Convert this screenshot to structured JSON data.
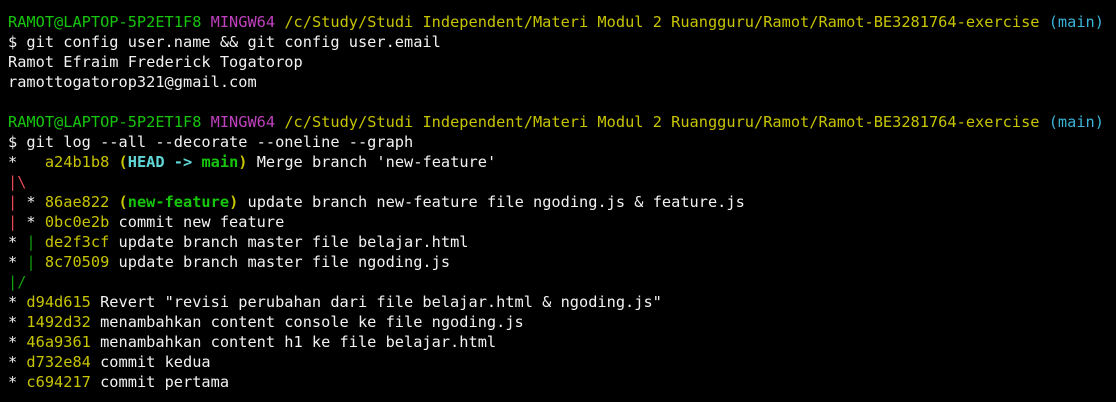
{
  "prompt1": {
    "user": "RAMOT@LAPTOP-5P2ET1F8",
    "shell": "MINGW64",
    "path": "/c/Study/Studi Independent/Materi Modul 2 Ruangguru/Ramot/Ramot-BE3281764-exercise",
    "branch": "(main)"
  },
  "cmd1": "$ git config user.name && git config user.email",
  "out_name": "Ramot Efraim Frederick Togatorop",
  "out_email": "ramottogatorop321@gmail.com",
  "prompt2": {
    "user": "RAMOT@LAPTOP-5P2ET1F8",
    "shell": "MINGW64",
    "path": "/c/Study/Studi Independent/Materi Modul 2 Ruangguru/Ramot/Ramot-BE3281764-exercise",
    "branch": "(main)"
  },
  "cmd2": "$ git log --all --decorate --oneline --graph",
  "log": [
    {
      "graph": "*   ",
      "hash": "a24b1b8",
      "ref_open": "(",
      "ref_head": "HEAD -> ",
      "ref_branch": "main",
      "ref_close": ")",
      "msg": " Merge branch 'new-feature'"
    },
    {
      "graph_red": "|\\"
    },
    {
      "graph_red": "| ",
      "graph2": "* ",
      "hash": "86ae822",
      "ref_open": "(",
      "ref_branch": "new-feature",
      "ref_close": ")",
      "msg": " update branch new-feature file ngoding.js & feature.js"
    },
    {
      "graph_red": "| ",
      "graph2": "* ",
      "hash": "0bc0e2b",
      "msg": " commit new feature"
    },
    {
      "graph": "* ",
      "graph_green": "| ",
      "hash": "de2f3cf",
      "msg": " update branch master file belajar.html"
    },
    {
      "graph": "* ",
      "graph_green": "| ",
      "hash": "8c70509",
      "msg": " update branch master file ngoding.js"
    },
    {
      "graph_green": "|/"
    },
    {
      "graph": "* ",
      "hash": "d94d615",
      "msg": " Revert \"revisi perubahan dari file belajar.html & ngoding.js\""
    },
    {
      "graph": "* ",
      "hash": "1492d32",
      "msg": " menambahkan content console ke file ngoding.js"
    },
    {
      "graph": "* ",
      "hash": "46a9361",
      "msg": " menambahkan content h1 ke file belajar.html"
    },
    {
      "graph": "* ",
      "hash": "d732e84",
      "msg": " commit kedua"
    },
    {
      "graph": "* ",
      "hash": "c694217",
      "msg": " commit pertama"
    }
  ]
}
